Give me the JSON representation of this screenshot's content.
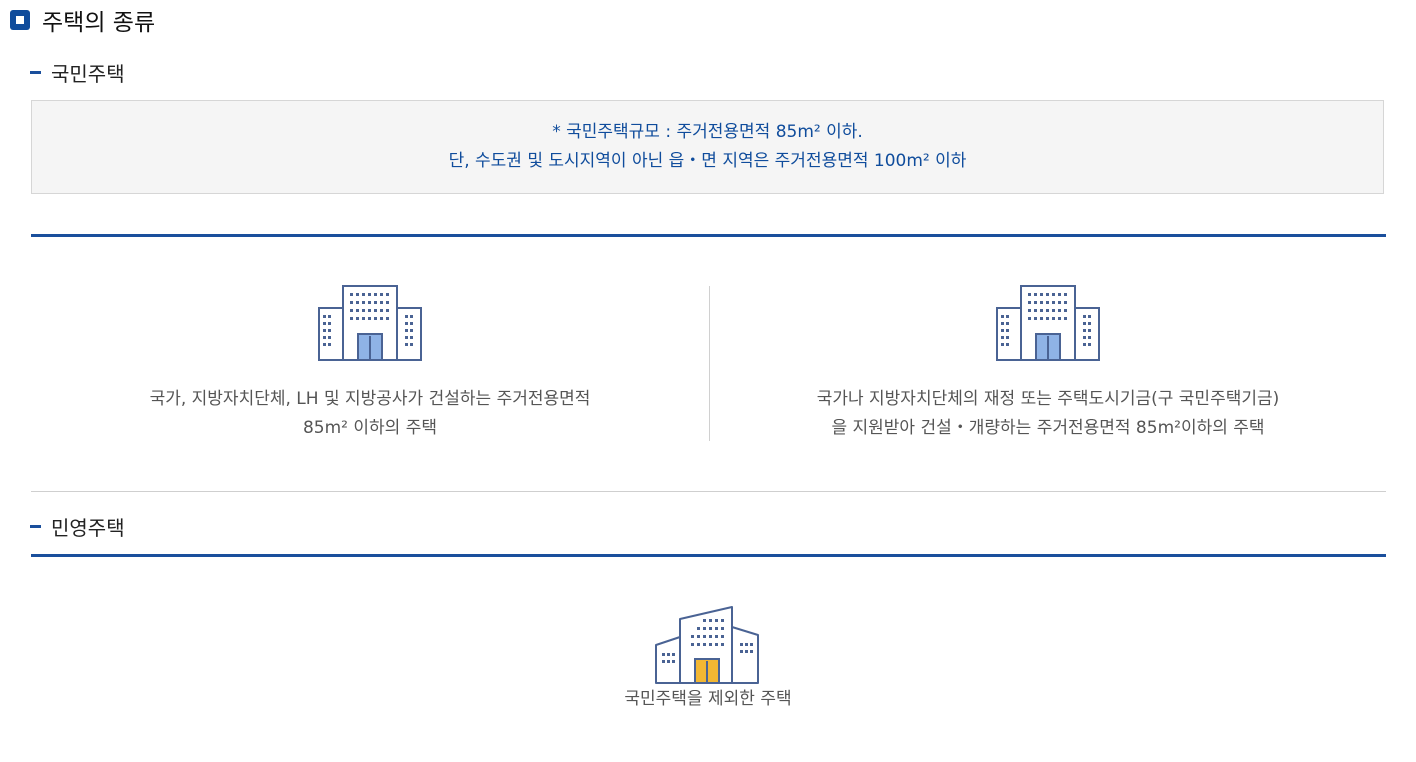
{
  "page": {
    "title": "주택의 종류"
  },
  "national": {
    "heading": "국민주택",
    "note_line1": "* 국민주택규모 : 주거전용면적 85m² 이하.",
    "note_line2": "단, 수도권 및 도시지역이 아닌 읍・면 지역은 주거전용면적 100m² 이하",
    "cards": [
      {
        "icon": "building-icon",
        "line1": "국가, 지방자치단체, LH 및 지방공사가 건설하는 주거전용면적",
        "line2": "85m² 이하의 주택"
      },
      {
        "icon": "building-icon",
        "line1": "국가나 지방자치단체의 재정 또는 주택도시기금(구 국민주택기금)",
        "line2": "을 지원받아 건설・개량하는 주거전용면적 85m²이하의 주택"
      }
    ]
  },
  "private": {
    "heading": "민영주택",
    "card": {
      "icon": "private-building-icon",
      "line1": "국민주택을 제외한 주택"
    }
  },
  "colors": {
    "accent": "#1a4f9c",
    "note_text": "#0f4c9c",
    "national_door": "#8fb3e6",
    "private_door": "#f2b733"
  }
}
